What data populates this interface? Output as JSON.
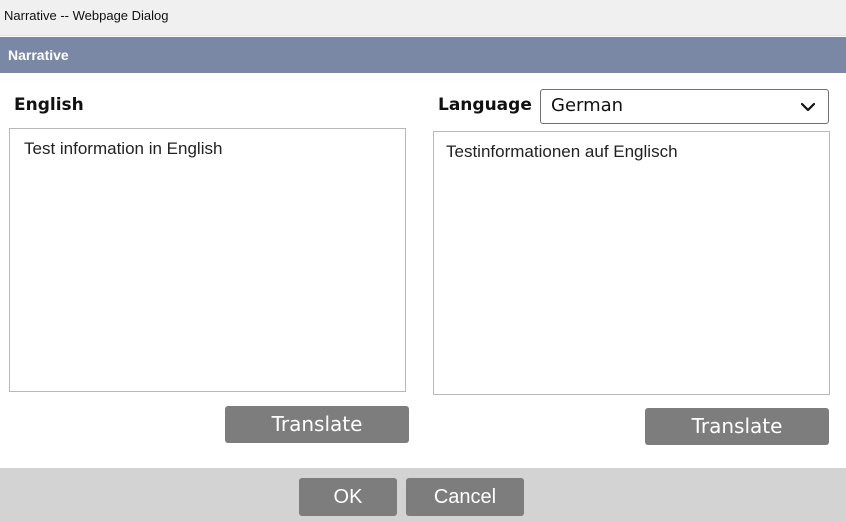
{
  "window": {
    "title": "Narrative -- Webpage Dialog"
  },
  "header": {
    "title": "Narrative"
  },
  "english_panel": {
    "label": "English",
    "text": "Test information in English",
    "translate_label": "Translate"
  },
  "language_panel": {
    "label": "Language",
    "selected_language": "German",
    "dropdown_icon": "chevron-down-icon",
    "text": "Testinformationen auf Englisch",
    "translate_label": "Translate"
  },
  "footer": {
    "ok_label": "OK",
    "cancel_label": "Cancel"
  },
  "colors": {
    "header_band": "#7b88a5",
    "button": "#7d7d7d",
    "footer": "#d3d3d3"
  }
}
